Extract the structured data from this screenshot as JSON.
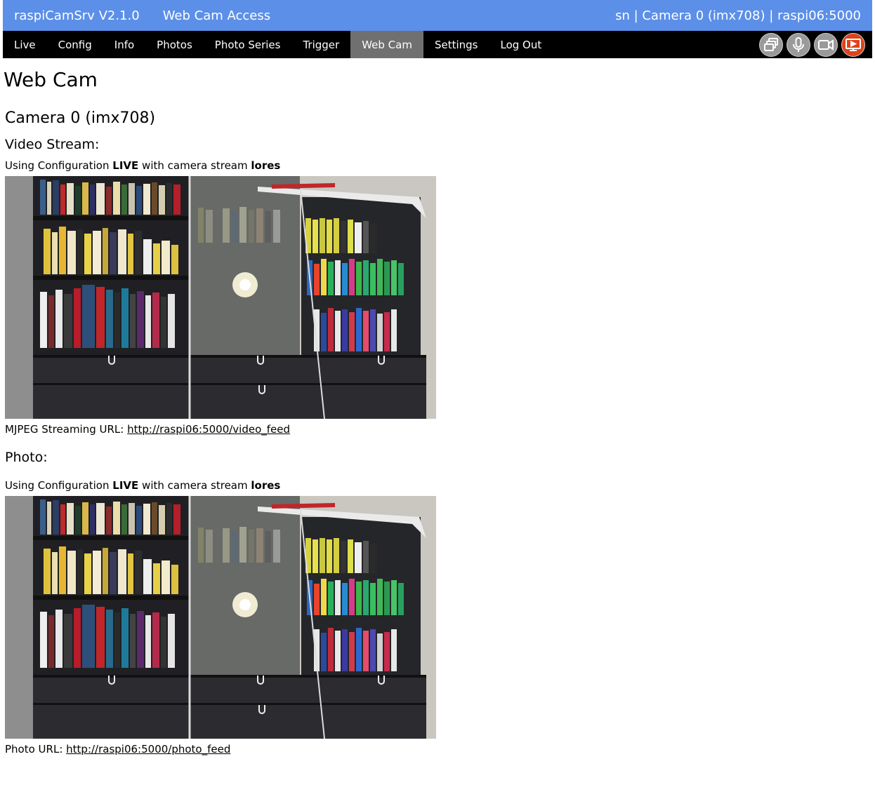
{
  "header": {
    "app_name": "raspiCamSrv V2.1.0",
    "subtitle": "Web Cam Access",
    "status": "sn | Camera 0 (imx708) | raspi06:5000",
    "color": "#5b8fe8"
  },
  "nav": {
    "items": [
      {
        "label": "Live"
      },
      {
        "label": "Config"
      },
      {
        "label": "Info"
      },
      {
        "label": "Photos"
      },
      {
        "label": "Photo Series"
      },
      {
        "label": "Trigger"
      },
      {
        "label": "Web Cam",
        "active": true
      },
      {
        "label": "Settings"
      },
      {
        "label": "Log Out"
      }
    ],
    "icons": [
      "windows-icon",
      "microphone-icon",
      "video-camera-icon",
      "screen-record-icon"
    ],
    "active_icon_color": "#e0431b"
  },
  "page": {
    "title": "Web Cam",
    "camera_heading": "Camera 0 (imx708)",
    "video": {
      "heading": "Video Stream:",
      "config_prefix": "Using Configuration",
      "config_name": "LIVE",
      "config_mid": "with camera stream",
      "stream_name": "lores",
      "url_label": "MJPEG Streaming URL:",
      "url": "http://raspi06:5000/video_feed"
    },
    "photo": {
      "heading": "Photo:",
      "config_prefix": "Using Configuration",
      "config_name": "LIVE",
      "config_mid": "with camera stream",
      "stream_name": "lores",
      "url_label": "Photo URL:",
      "url": "http://raspi06:5000/photo_feed"
    }
  }
}
